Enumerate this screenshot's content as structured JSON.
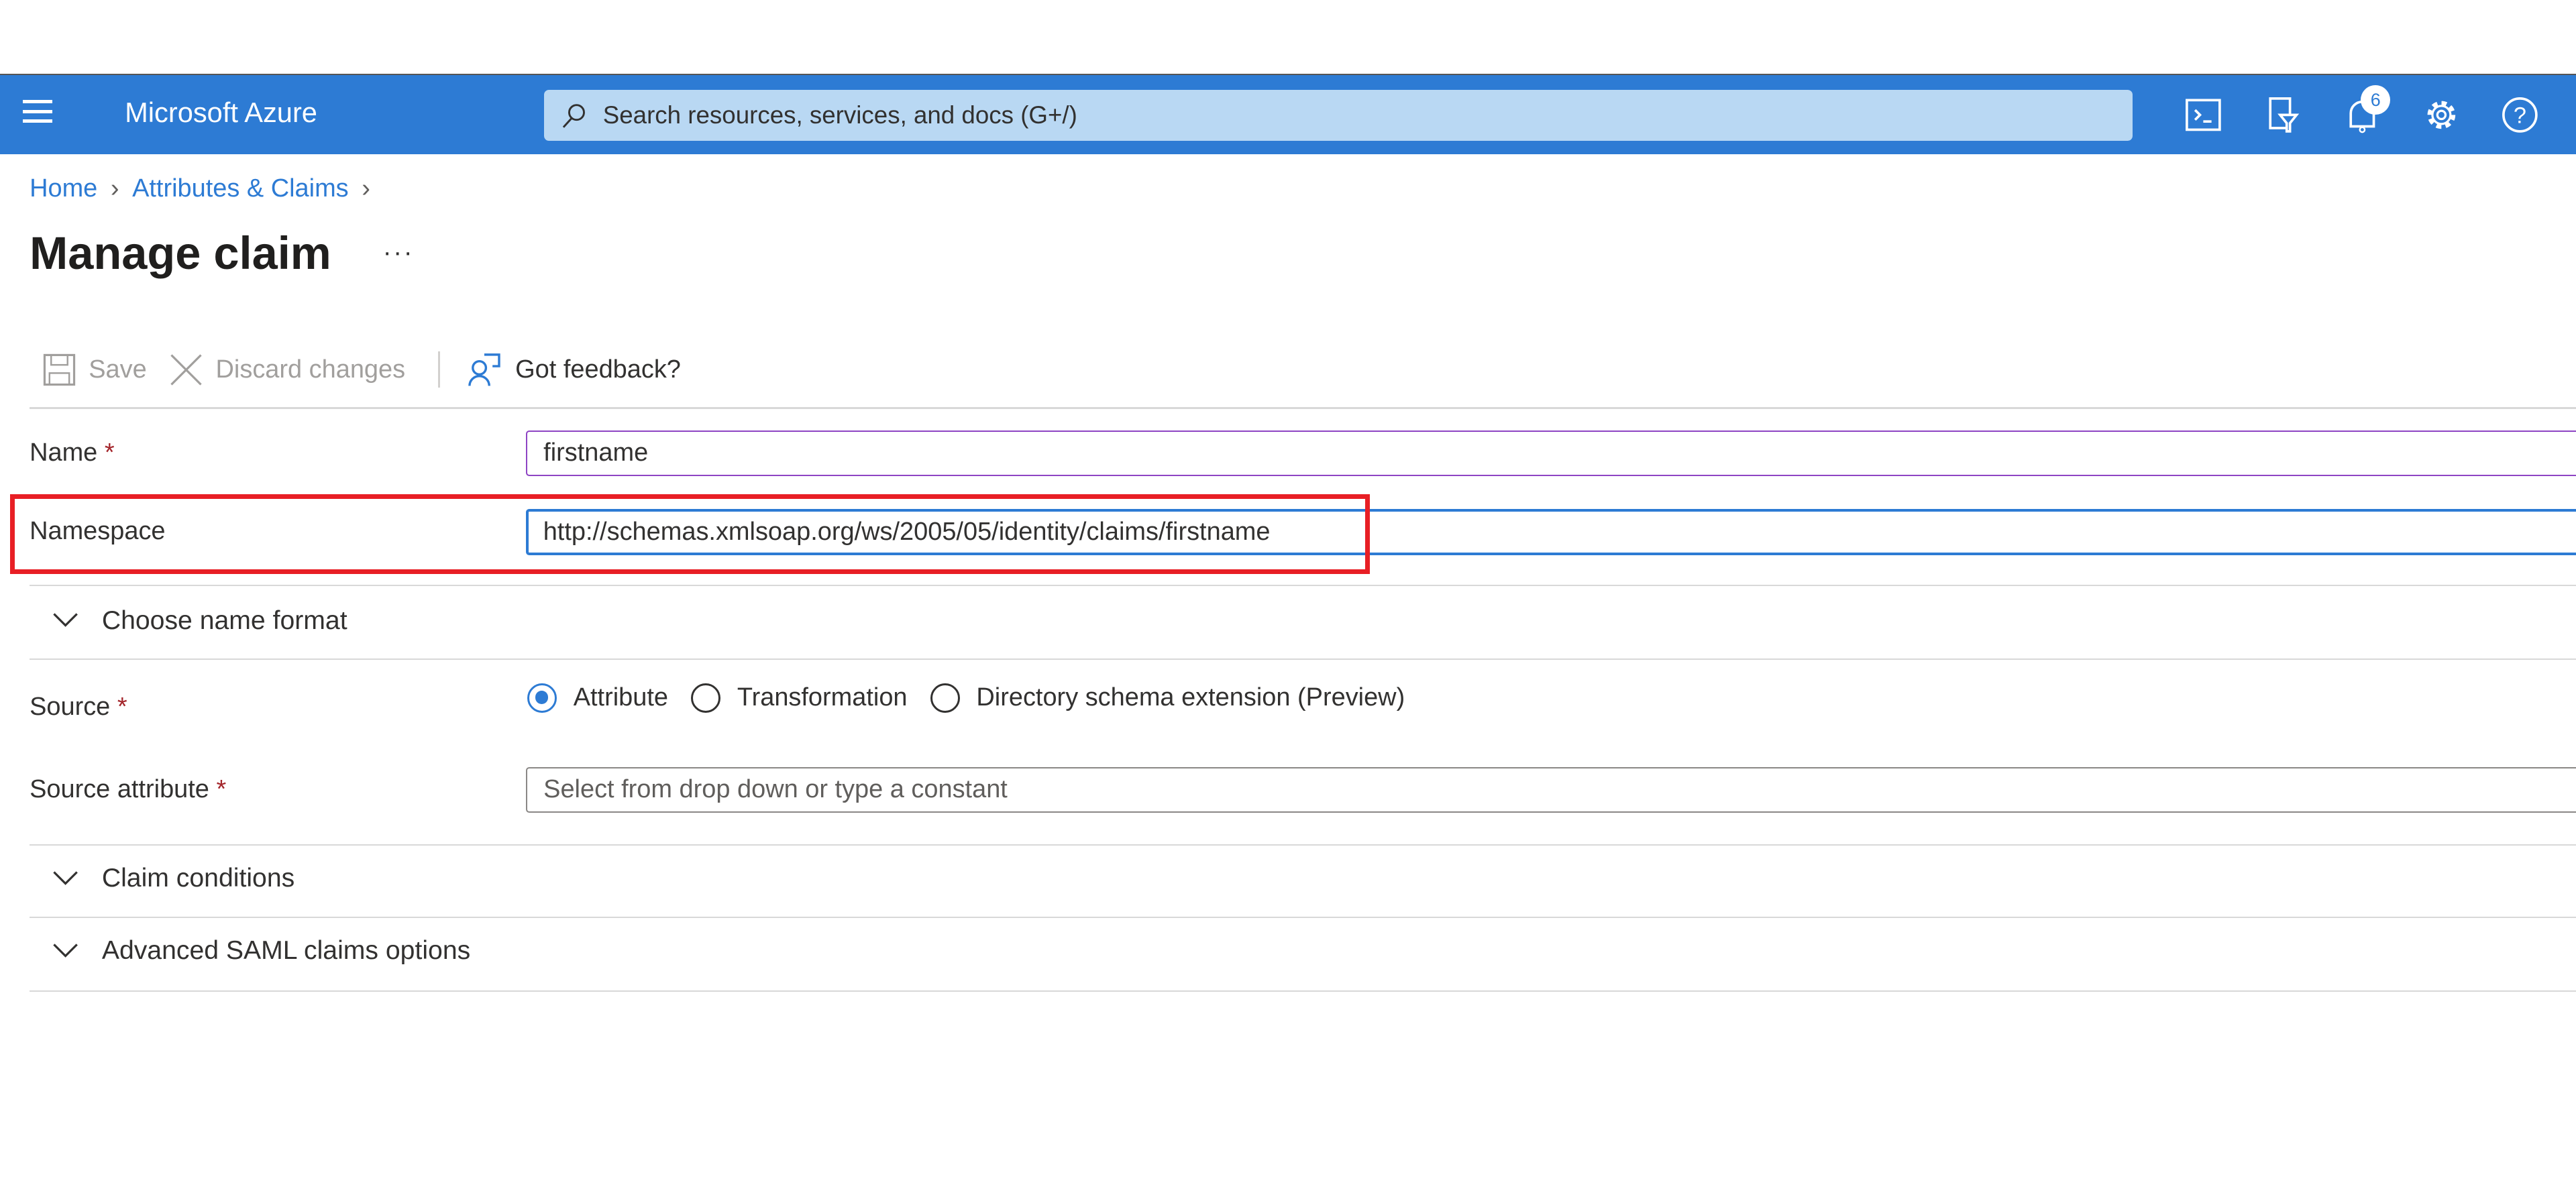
{
  "header": {
    "brand": "Microsoft Azure",
    "search_placeholder": "Search resources, services, and docs (G+/)",
    "notification_count": "6",
    "icons": [
      "menu-icon",
      "cloud-shell-icon",
      "directory-filter-icon",
      "bell-icon",
      "gear-icon",
      "help-icon"
    ],
    "accent_color": "#2d7bd4"
  },
  "breadcrumb": [
    "Home",
    "Attributes & Claims"
  ],
  "page": {
    "title": "Manage claim",
    "more": "···"
  },
  "toolbar": {
    "save": "Save",
    "discard": "Discard changes",
    "feedback": "Got feedback?"
  },
  "form": {
    "name_label": "Name",
    "name_value": "firstname",
    "namespace_label": "Namespace",
    "namespace_value": "http://schemas.xmlsoap.org/ws/2005/05/identity/claims/firstname",
    "required_mark": "*",
    "choose_name_format": "Choose name format",
    "source_label": "Source",
    "source_options": [
      {
        "label": "Attribute",
        "selected": true
      },
      {
        "label": "Transformation",
        "selected": false
      },
      {
        "label": "Directory schema extension (Preview)",
        "selected": false
      }
    ],
    "source_attribute_label": "Source attribute",
    "source_attribute_placeholder": "Select from drop down or type a constant",
    "claim_conditions": "Claim conditions",
    "advanced_saml": "Advanced SAML claims options"
  },
  "highlight_color": "#e81f25"
}
